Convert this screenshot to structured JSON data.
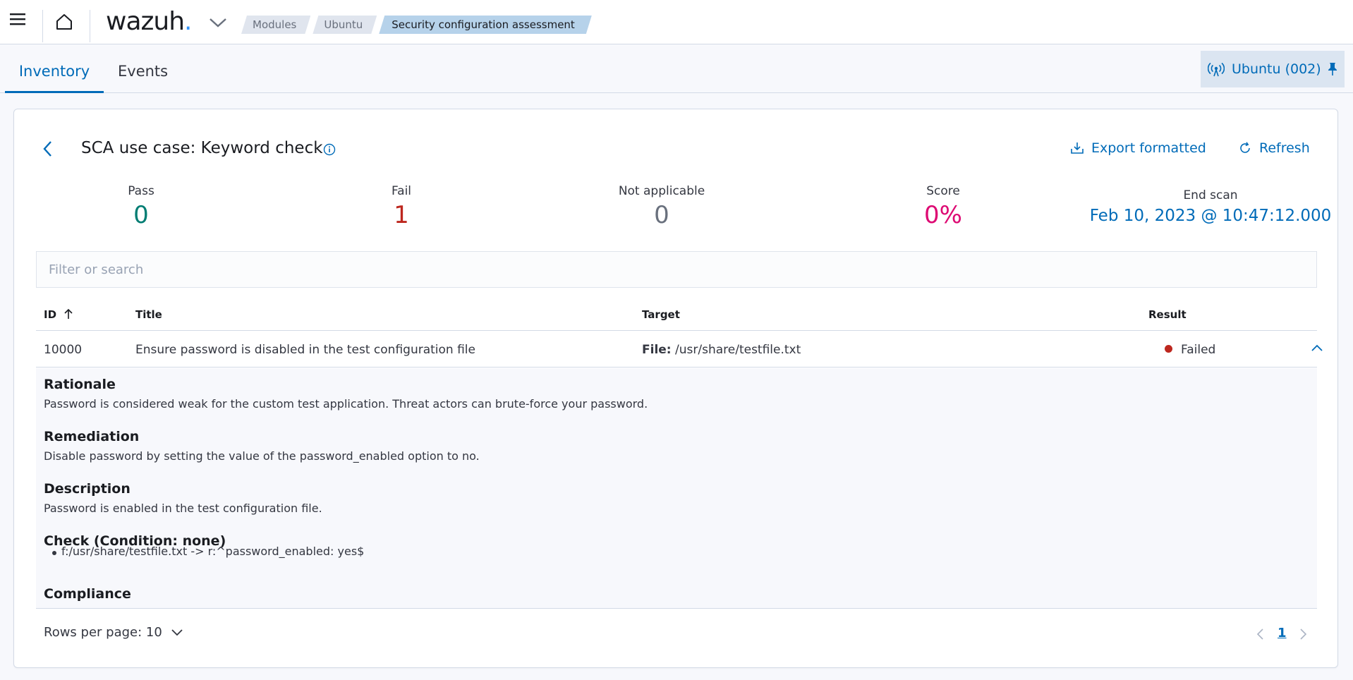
{
  "header": {
    "logo_text": "wazuh",
    "logo_dot": ".",
    "breadcrumbs": [
      "Modules",
      "Ubuntu",
      "Security configuration assessment"
    ]
  },
  "tabs": [
    {
      "label": "Inventory",
      "active": true
    },
    {
      "label": "Events",
      "active": false
    }
  ],
  "agent": {
    "label": "Ubuntu (002)"
  },
  "panel": {
    "title": "SCA use case: Keyword check",
    "export_label": "Export formatted",
    "refresh_label": "Refresh"
  },
  "stats": {
    "pass": {
      "title": "Pass",
      "value": "0",
      "color": "#017d73"
    },
    "fail": {
      "title": "Fail",
      "value": "1",
      "color": "#bd271e"
    },
    "not_applicable": {
      "title": "Not applicable",
      "value": "0",
      "color": "#69707d"
    },
    "score": {
      "title": "Score",
      "value": "0%",
      "color": "#dd0a73"
    },
    "end_scan": {
      "title": "End scan",
      "value": "Feb 10, 2023 @ 10:47:12.000",
      "color": "#006bb8"
    }
  },
  "search": {
    "placeholder": "Filter or search",
    "value": ""
  },
  "table": {
    "columns": [
      "ID",
      "Title",
      "Target",
      "Result"
    ],
    "rows": [
      {
        "id": "10000",
        "title": "Ensure password is disabled in the test configuration file",
        "target_label": "File:",
        "target_value": "/usr/share/testfile.txt",
        "result": "Failed"
      }
    ]
  },
  "details": {
    "rationale": {
      "heading": "Rationale",
      "text": "Password is considered weak for the custom test application. Threat actors can brute-force your password."
    },
    "remediation": {
      "heading": "Remediation",
      "text": "Disable password by setting the value of the password_enabled option to no."
    },
    "description": {
      "heading": "Description",
      "text": "Password is enabled in the test configuration file."
    },
    "check": {
      "heading": "Check (Condition: none)",
      "rules": [
        "f:/usr/share/testfile.txt -> r:^password_enabled: yes$"
      ]
    },
    "compliance": {
      "heading": "Compliance"
    }
  },
  "pagination": {
    "rows_per_page": "Rows per page: 10",
    "current_page": "1"
  },
  "colors": {
    "accent": "#006bb8",
    "failed": "#bd271e"
  }
}
